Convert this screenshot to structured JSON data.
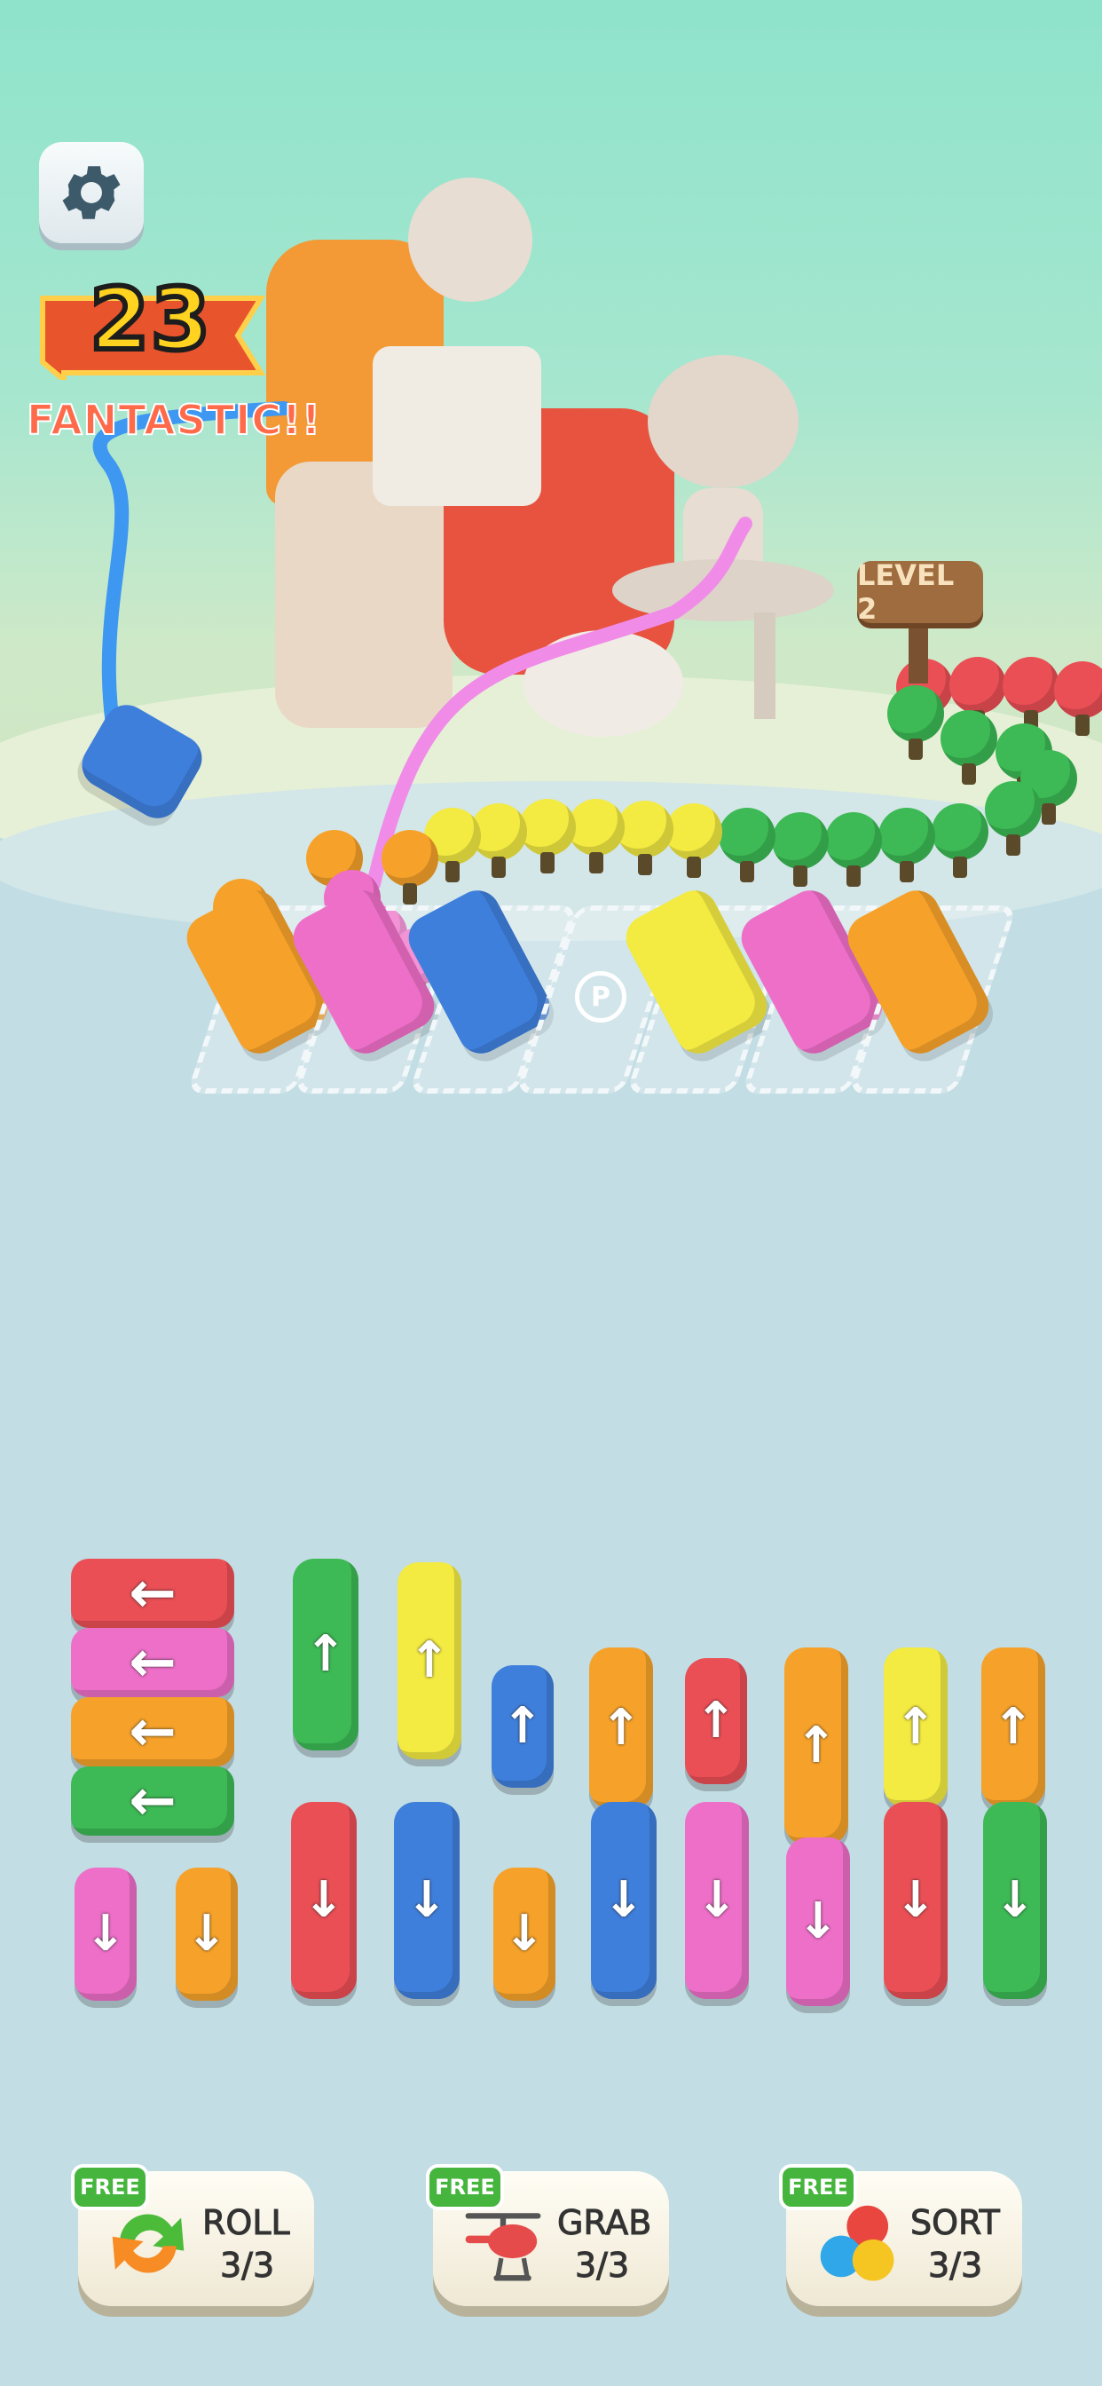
{
  "hud": {
    "combo_count": "23",
    "combo_message": "FANTASTIC!!",
    "level_label": "LEVEL 2"
  },
  "tools": [
    {
      "name": "roll",
      "badge": "FREE",
      "label": "ROLL",
      "count": "3/3",
      "icon": "roll-arrows-icon"
    },
    {
      "name": "grab",
      "badge": "FREE",
      "label": "GRAB",
      "count": "3/3",
      "icon": "helicopter-icon"
    },
    {
      "name": "sort",
      "badge": "FREE",
      "label": "SORT",
      "count": "3/3",
      "icon": "sort-balls-icon"
    }
  ],
  "colors": {
    "red": "#ea4f55",
    "pink": "#ee6fc8",
    "orange": "#f6a22a",
    "green": "#3dba55",
    "yellow": "#f3ea42",
    "blue": "#3f7fdc",
    "free_badge": "#46b53d"
  },
  "parking_slots": [
    {
      "id": 1,
      "state": "occupied",
      "bus_color": "orange"
    },
    {
      "id": 2,
      "state": "occupied",
      "bus_color": "pink"
    },
    {
      "id": 3,
      "state": "occupied",
      "bus_color": "blue"
    },
    {
      "id": 4,
      "state": "empty",
      "label": "P"
    },
    {
      "id": 5,
      "state": "occupied",
      "bus_color": "yellow"
    },
    {
      "id": 6,
      "state": "occupied",
      "bus_color": "pink"
    },
    {
      "id": 7,
      "state": "occupied",
      "bus_color": "orange"
    }
  ],
  "vehicle_grid": [
    {
      "color": "red",
      "dir": "left",
      "size": "bus"
    },
    {
      "color": "pink",
      "dir": "left",
      "size": "bus"
    },
    {
      "color": "orange",
      "dir": "left",
      "size": "bus"
    },
    {
      "color": "green",
      "dir": "left",
      "size": "bus"
    },
    {
      "color": "pink",
      "dir": "down",
      "size": "car"
    },
    {
      "color": "orange",
      "dir": "down",
      "size": "car"
    },
    {
      "color": "green",
      "dir": "up",
      "size": "bus"
    },
    {
      "color": "yellow",
      "dir": "up",
      "size": "bus"
    },
    {
      "color": "red",
      "dir": "down",
      "size": "bus"
    },
    {
      "color": "blue",
      "dir": "down",
      "size": "bus"
    },
    {
      "color": "blue",
      "dir": "up",
      "size": "car"
    },
    {
      "color": "orange",
      "dir": "down",
      "size": "car"
    },
    {
      "color": "orange",
      "dir": "up",
      "size": "van"
    },
    {
      "color": "blue",
      "dir": "down",
      "size": "bus"
    },
    {
      "color": "red",
      "dir": "up",
      "size": "car"
    },
    {
      "color": "pink",
      "dir": "down",
      "size": "bus"
    },
    {
      "color": "orange",
      "dir": "up",
      "size": "bus"
    },
    {
      "color": "pink",
      "dir": "down",
      "size": "van"
    },
    {
      "color": "yellow",
      "dir": "up",
      "size": "van"
    },
    {
      "color": "red",
      "dir": "down",
      "size": "bus"
    },
    {
      "color": "orange",
      "dir": "up",
      "size": "van"
    },
    {
      "color": "green",
      "dir": "down",
      "size": "bus"
    }
  ]
}
